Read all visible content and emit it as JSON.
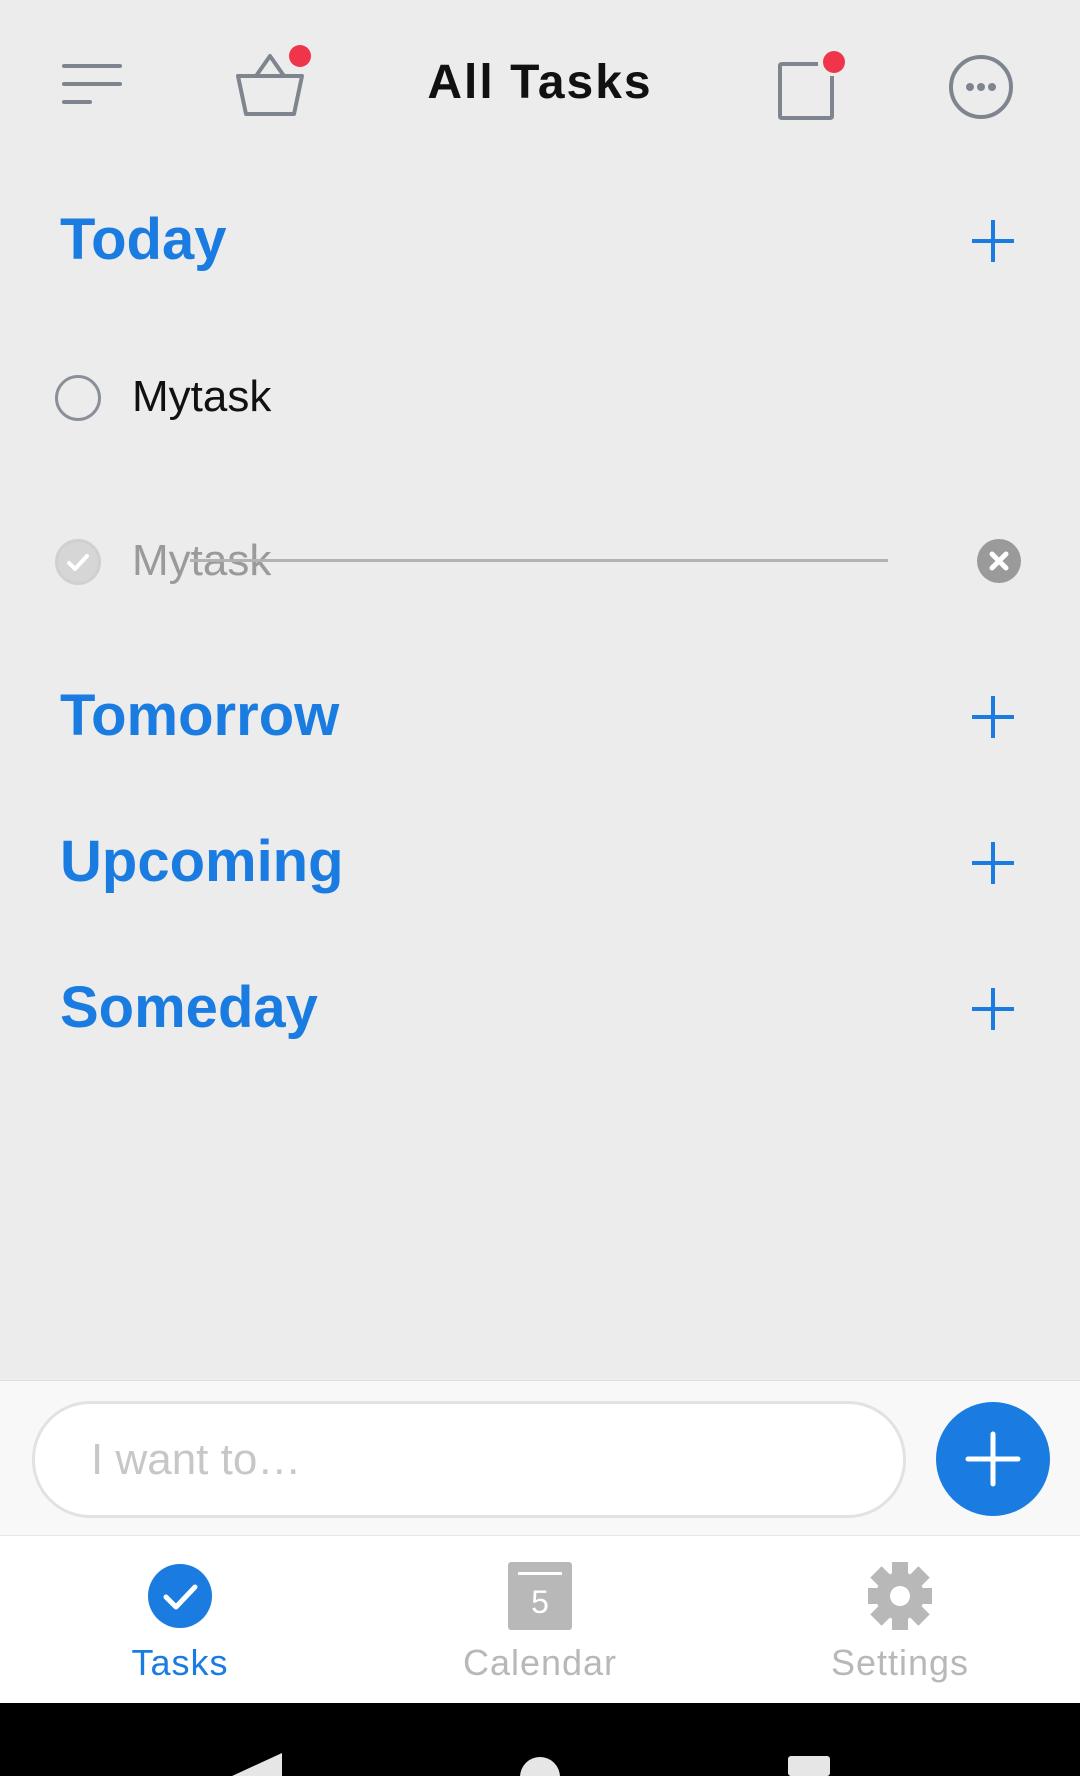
{
  "header": {
    "title": "All Tasks",
    "icons": [
      "menu-icon",
      "basket-icon",
      "notes-icon",
      "more-icon"
    ],
    "badge_color": "#f0354a"
  },
  "sections": [
    {
      "title": "Today"
    },
    {
      "title": "Tomorrow"
    },
    {
      "title": "Upcoming"
    },
    {
      "title": "Someday"
    }
  ],
  "tasks": [
    {
      "label": "Mytask",
      "done": false
    },
    {
      "label": "Mytask",
      "done": true
    }
  ],
  "input": {
    "placeholder": "I want to…"
  },
  "tabs": [
    {
      "label": "Tasks",
      "icon": "check-circle-icon",
      "active": true
    },
    {
      "label": "Calendar",
      "icon": "calendar-icon",
      "active": false,
      "calendar_day": "5"
    },
    {
      "label": "Settings",
      "icon": "gear-icon",
      "active": false
    }
  ],
  "colors": {
    "accent": "#1a7ce0",
    "background": "#ececec",
    "inactive_tab": "#b8b8b8",
    "badge": "#f0354a"
  }
}
